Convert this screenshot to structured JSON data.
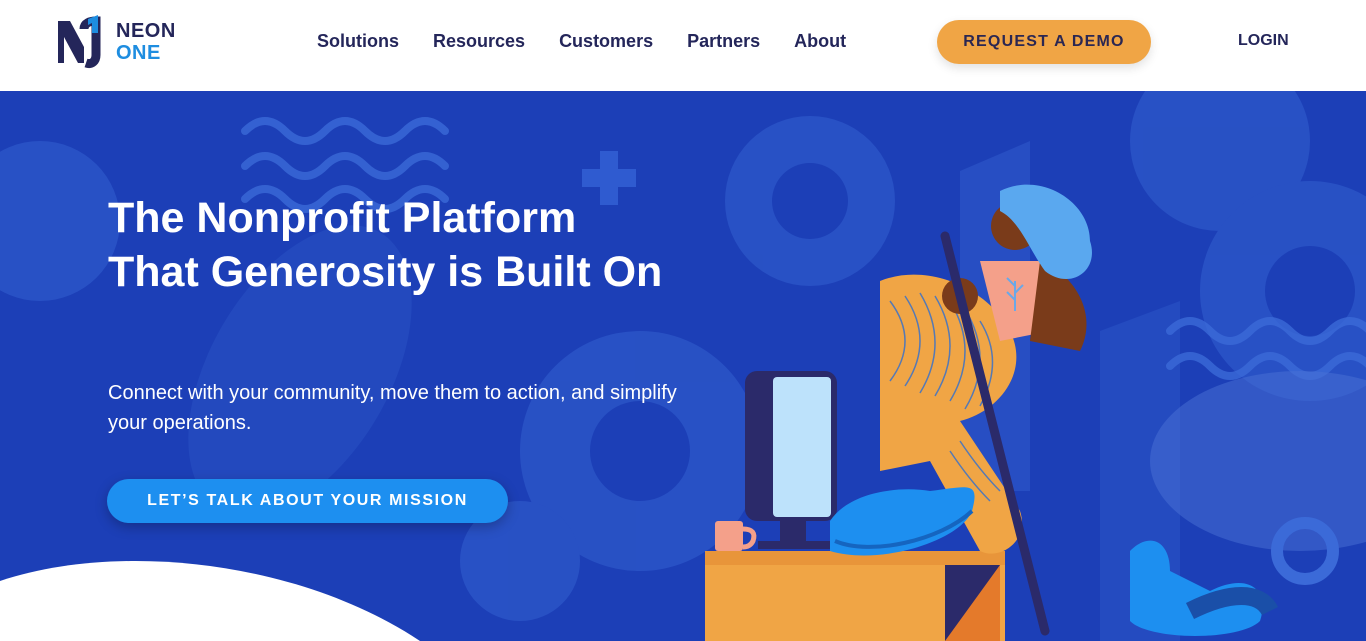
{
  "brand": {
    "logo_line1": "NEON",
    "logo_line2": "ONE",
    "primary": "#24265a",
    "accent_blue": "#1e8de0",
    "accent_orange": "#f0a545"
  },
  "nav": {
    "items": [
      {
        "label": "Solutions"
      },
      {
        "label": "Resources"
      },
      {
        "label": "Customers"
      },
      {
        "label": "Partners"
      },
      {
        "label": "About"
      }
    ],
    "demo_label": "REQUEST A DEMO",
    "login_label": "LOGIN"
  },
  "hero": {
    "title": "The Nonprofit Platform That Generosity is Built On",
    "subtitle": "Connect with your community, move them to action, and simplify your operations.",
    "cta_label": "LET’S TALK ABOUT YOUR MISSION",
    "bg_color": "#1c3fb7"
  }
}
